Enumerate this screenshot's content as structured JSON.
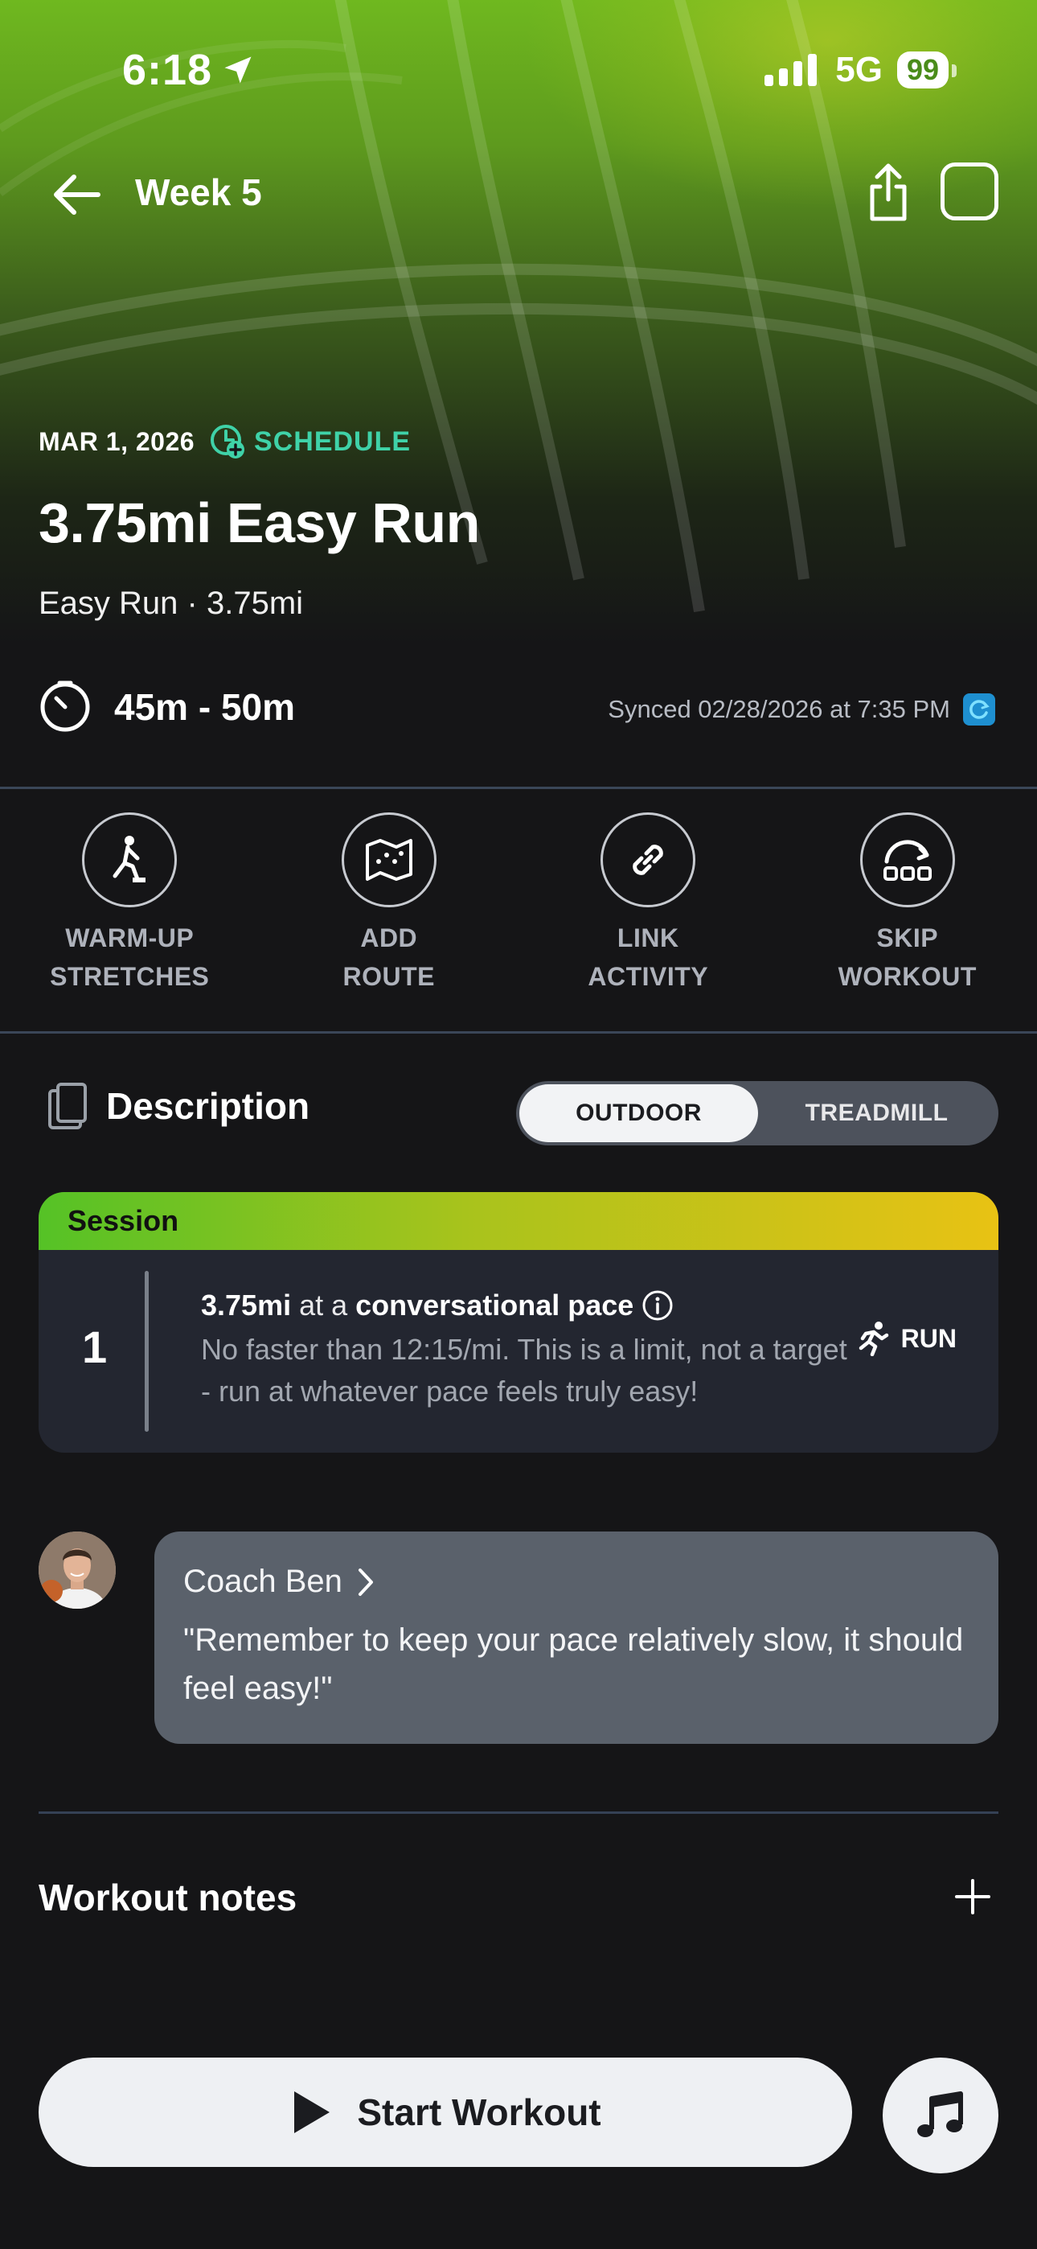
{
  "status_bar": {
    "time": "6:18",
    "network": "5G",
    "battery": "99"
  },
  "nav": {
    "title": "Week 5"
  },
  "workout": {
    "date": "MAR 1, 2026",
    "schedule_label": "SCHEDULE",
    "title": "3.75mi Easy Run",
    "subtitle": "Easy Run · 3.75mi",
    "duration": "45m - 50m",
    "synced": "Synced 02/28/2026 at 7:35 PM"
  },
  "actions": [
    {
      "line1": "WARM-UP",
      "line2": "STRETCHES",
      "icon": "stretch-icon"
    },
    {
      "line1": "ADD",
      "line2": "ROUTE",
      "icon": "map-icon"
    },
    {
      "line1": "LINK",
      "line2": "ACTIVITY",
      "icon": "link-icon"
    },
    {
      "line1": "SKIP",
      "line2": "WORKOUT",
      "icon": "skip-icon"
    }
  ],
  "description": {
    "title": "Description",
    "toggle": {
      "outdoor": "OUTDOOR",
      "treadmill": "TREADMILL",
      "selected": "OUTDOOR"
    }
  },
  "session": {
    "header": "Session",
    "step": {
      "number": "1",
      "distance": "3.75mi",
      "connector": "at a",
      "pace": "conversational pace",
      "detail": "No faster than 12:15/mi. This is a limit, not a target - run at whatever pace feels truly easy!",
      "type": "RUN"
    }
  },
  "coach": {
    "name": "Coach Ben",
    "quote": "\"Remember to keep your pace relatively slow, it should feel easy!\""
  },
  "notes": {
    "title": "Workout notes"
  },
  "start_button": {
    "label": "Start Workout"
  },
  "colors": {
    "accent_teal": "#3fd2a8",
    "hero_green": "#6fb81f",
    "session_yellow": "#e8c214"
  }
}
